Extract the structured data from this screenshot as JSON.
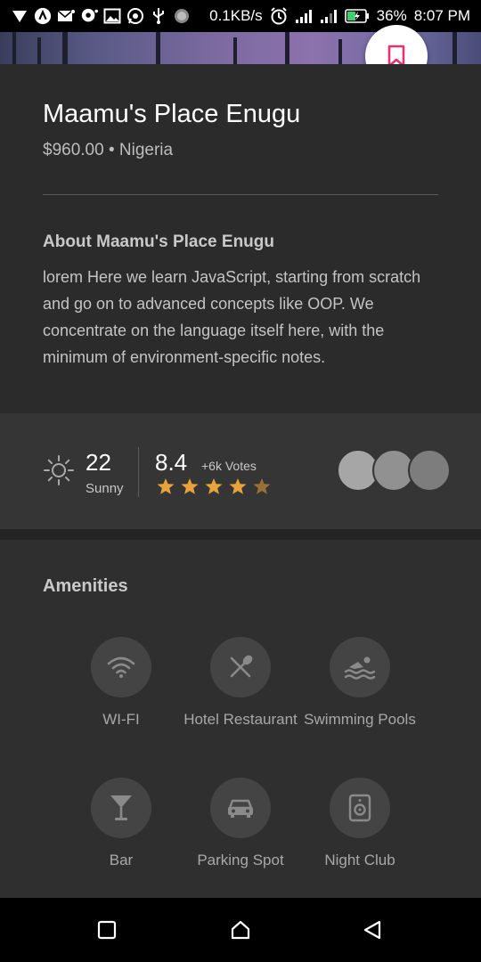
{
  "status_bar": {
    "speed": "0.1KB/s",
    "battery": "36%",
    "time": "8:07 PM",
    "icons": [
      "check-icon",
      "nav-app-icon",
      "mail-icon",
      "chat-icon",
      "image-icon",
      "whatsapp-icon",
      "usb-icon",
      "dot-icon",
      "alarm-icon",
      "signal-icon",
      "signal-icon",
      "battery-charging-icon"
    ]
  },
  "listing": {
    "title": "Maamu's Place Enugu",
    "price": "$960.00",
    "separator": "•",
    "country": "Nigeria",
    "about_heading": "About Maamu's Place Enugu",
    "about_text": "lorem Here we learn JavaScript, starting from scratch and go on to advanced concepts like OOP. We concentrate on the language itself here, with the minimum of environment-specific notes."
  },
  "stats": {
    "temperature": "22",
    "condition": "Sunny",
    "rating": "8.4",
    "votes": "+6k Votes",
    "stars": 4.5,
    "colors": {
      "star": "#e8a33a",
      "bookmark": "#e5336b"
    }
  },
  "amenities": {
    "heading": "Amenities",
    "items": [
      {
        "label": "WI-FI",
        "icon": "wifi-icon"
      },
      {
        "label": "Hotel Restaurant",
        "icon": "cutlery-icon"
      },
      {
        "label": "Swimming Pools",
        "icon": "swimmer-icon"
      },
      {
        "label": "Bar",
        "icon": "cocktail-icon"
      },
      {
        "label": "Parking Spot",
        "icon": "car-icon"
      },
      {
        "label": "Night Club",
        "icon": "speaker-icon"
      }
    ]
  }
}
